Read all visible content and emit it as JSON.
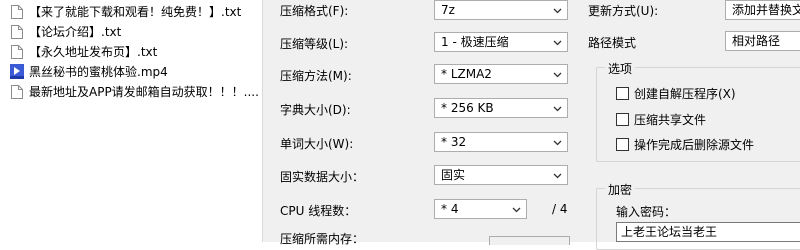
{
  "files": [
    {
      "name": "【来了就能下载和观看！纯免费！】.txt",
      "type": "txt"
    },
    {
      "name": "【论坛介绍】.txt",
      "type": "txt"
    },
    {
      "name": "【永久地址发布页】.txt",
      "type": "txt"
    },
    {
      "name": "黑丝秘书的蜜桃体验.mp4",
      "type": "mp4"
    },
    {
      "name": "最新地址及APP请发邮箱自动获取！！！....",
      "type": "txt"
    }
  ],
  "form": {
    "format_label": "压缩格式(F):",
    "format_value": "7z",
    "level_label": "压缩等级(L):",
    "level_value": "1 - 极速压缩",
    "method_label": "压缩方法(M):",
    "method_value": "* LZMA2",
    "dict_label": "字典大小(D):",
    "dict_value": "* 256 KB",
    "word_label": "单词大小(W):",
    "word_value": "* 32",
    "solid_label": "固实数据大小：",
    "solid_value": "固实",
    "threads_label": "CPU 线程数：",
    "threads_value": "* 4",
    "threads_total": "/ 4",
    "memory_label": "压缩所需内存："
  },
  "right": {
    "update_label": "更新方式(U):",
    "update_value": "添加并替换文",
    "path_label": "路径模式",
    "path_value": "相对路径",
    "options_title": "选项",
    "opt_sfx": "创建自解压程序(X)",
    "opt_shared": "压缩共享文件",
    "opt_delete": "操作完成后删除源文件",
    "encrypt_title": "加密",
    "password_label": "输入密码：",
    "password_value": "上老王论坛当老王"
  }
}
